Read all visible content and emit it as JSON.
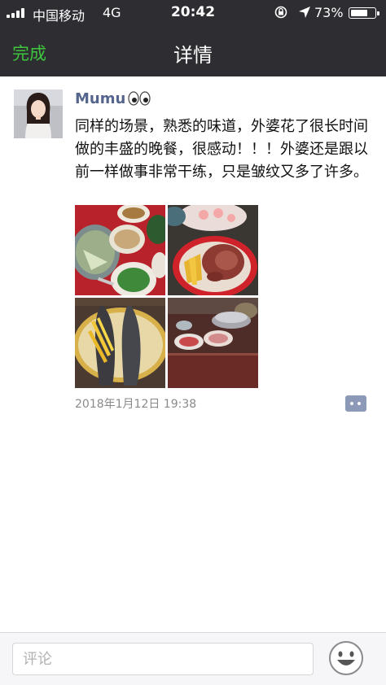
{
  "status_bar": {
    "carrier": "中国移动",
    "network": "4G",
    "time": "20:42",
    "battery_percent": "73%",
    "battery_level": 0.73,
    "signal_bars": 4,
    "icons": [
      "rotation-lock-icon",
      "location-arrow-icon"
    ]
  },
  "nav": {
    "done_label": "完成",
    "title": "详情"
  },
  "post": {
    "author": "Mumu",
    "text": "同样的场景，熟悉的味道，外婆花了很长时间做的丰盛的晚餐，很感动！！！外婆还是跟以前一样做事非常干练，只是皱纹又多了许多。",
    "timestamp": "2018年1月12日 19:38",
    "photos": [
      {
        "name": "photo-dishes-table"
      },
      {
        "name": "photo-raw-meat-plate"
      },
      {
        "name": "photo-fish-plate"
      },
      {
        "name": "photo-kitchen-stove"
      }
    ]
  },
  "comment_bar": {
    "placeholder": "评论"
  },
  "colors": {
    "bar_bg": "#2e2e32",
    "done_green": "#3ec53e",
    "username_blue": "#55658d",
    "comment_icon": "#8c9ab8"
  }
}
